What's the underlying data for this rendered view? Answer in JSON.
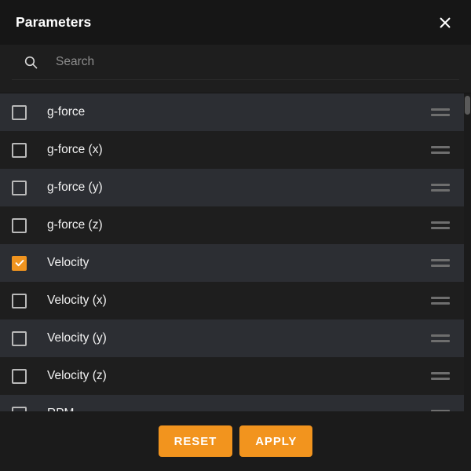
{
  "header": {
    "title": "Parameters",
    "close_icon": "close-icon"
  },
  "search": {
    "icon": "search-icon",
    "value": "",
    "placeholder": "Search"
  },
  "list": {
    "drag_handle_icon": "drag-handle-icon",
    "items": [
      {
        "label": "g-force",
        "checked": false
      },
      {
        "label": "g-force (x)",
        "checked": false
      },
      {
        "label": "g-force (y)",
        "checked": false
      },
      {
        "label": "g-force (z)",
        "checked": false
      },
      {
        "label": "Velocity",
        "checked": true
      },
      {
        "label": "Velocity (x)",
        "checked": false
      },
      {
        "label": "Velocity (y)",
        "checked": false
      },
      {
        "label": "Velocity (z)",
        "checked": false
      },
      {
        "label": "RPM",
        "checked": false
      }
    ]
  },
  "scrollbar": {
    "thumb_position_percent": 1,
    "thumb_size_percent": 6
  },
  "footer": {
    "reset_label": "RESET",
    "apply_label": "APPLY"
  },
  "colors": {
    "accent": "#f2941e",
    "panel_bg": "#1b1b1b",
    "header_bg": "#161616",
    "row_bg": "#1e1e1e",
    "row_alt_bg": "#2c2e33",
    "text": "#f2f2f2",
    "placeholder": "#8d8d8d"
  }
}
